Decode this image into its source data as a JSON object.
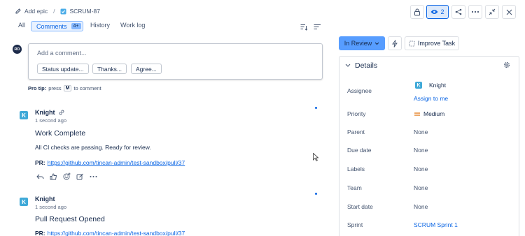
{
  "breadcrumb": {
    "add_epic": "Add epic",
    "separator": "/",
    "issue_key": "SCRUM-87"
  },
  "toolbar": {
    "watch_count": "2"
  },
  "tabs": [
    {
      "label": "All"
    },
    {
      "label": "Comments",
      "badge": "4+"
    },
    {
      "label": "History"
    },
    {
      "label": "Work log"
    }
  ],
  "composer": {
    "avatar_initials": "RD",
    "placeholder": "Add a comment...",
    "suggestions": [
      "Status update...",
      "Thanks...",
      "Agree..."
    ],
    "pro_tip_bold": "Pro tip:",
    "pro_tip_press": "press",
    "pro_tip_key": "M",
    "pro_tip_rest": "to comment"
  },
  "comments": [
    {
      "author": "Knight",
      "avatar_letter": "K",
      "time": "1 second ago",
      "title": "Work Complete",
      "body": "All CI checks are passing. Ready for review.",
      "pr_label": "PR:",
      "pr_url": "https://github.com/tincan-admin/test-sandbox/pull/37"
    },
    {
      "author": "Knight",
      "avatar_letter": "K",
      "time": "1 second ago",
      "title": "Pull Request Opened",
      "pr_label": "PR:",
      "pr_url": "https://github.com/tincan-admin/test-sandbox/pull/37"
    }
  ],
  "status": {
    "label": "In Review",
    "improve_label": "Improve Task"
  },
  "details": {
    "heading": "Details",
    "fields": [
      {
        "label": "Assignee",
        "value": "Knight",
        "action": "Assign to me"
      },
      {
        "label": "Priority",
        "value": "Medium"
      },
      {
        "label": "Parent",
        "value": "None"
      },
      {
        "label": "Due date",
        "value": "None"
      },
      {
        "label": "Labels",
        "value": "None"
      },
      {
        "label": "Team",
        "value": "None"
      },
      {
        "label": "Start date",
        "value": "None"
      },
      {
        "label": "Sprint",
        "value": "SCRUM Sprint 1"
      }
    ]
  },
  "colors": {
    "accent": "#0c66e4",
    "status_bg": "#579dff",
    "priority": "#e2740d",
    "agent_avatar": "#3fa9d8"
  }
}
